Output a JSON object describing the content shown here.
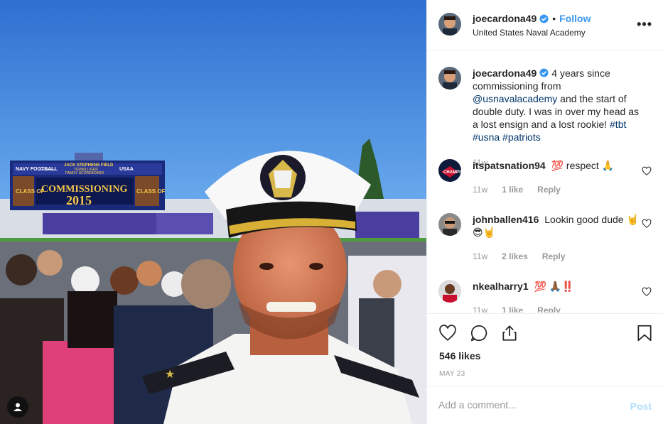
{
  "header": {
    "username": "joecardona49",
    "separator": "•",
    "follow_label": "Follow",
    "location": "United States Naval Academy",
    "more_label": "•••"
  },
  "photo": {
    "scoreboard": {
      "line1": "JACK STEPHENS FIELD",
      "line2": "TERWILLIGER",
      "line3": "FAMILY SCOREBOARD",
      "left_logo": "NAVY FOOTBALL",
      "sponsor": "Constellation",
      "right_logo": "USAA",
      "main_word": "COMMISSIONING",
      "year": "2015",
      "side_text_left": "CLASS OF",
      "side_text_right": "CLASS OF"
    }
  },
  "caption": {
    "username": "joecardona49",
    "text_before_mention": "4 years since commissioning from ",
    "mention": "@usnavalacademy",
    "text_after_mention": " and the start of double duty. I was in over my head as a lost ensign and a lost rookie! ",
    "hashtags": "#tbt #usna #patriots",
    "time": "11w"
  },
  "comments": [
    {
      "username": "itspatsnation94",
      "text": "💯 respect 🙏",
      "time": "11w",
      "likes": "1 like",
      "reply": "Reply"
    },
    {
      "username": "johnballen416",
      "text": "Lookin good dude 🤘😎🤘",
      "time": "11w",
      "likes": "2 likes",
      "reply": "Reply"
    },
    {
      "username": "nkealharry1",
      "text": "💯 🙏🏾‼️",
      "time": "11w",
      "likes": "1 like",
      "reply": "Reply"
    }
  ],
  "actions": {
    "likes": "546 likes",
    "date": "MAY 23"
  },
  "add_comment": {
    "placeholder": "Add a comment...",
    "post_label": "Post"
  },
  "colors": {
    "accent": "#3897f0",
    "link": "#003569",
    "muted": "#999999",
    "post_disabled": "#b2dffc"
  }
}
